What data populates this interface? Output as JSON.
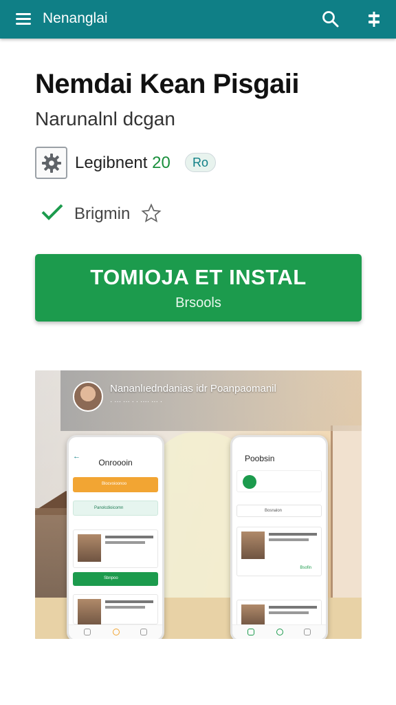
{
  "appbar": {
    "title": "Nenanglai",
    "icons": [
      "menu-icon",
      "search-icon",
      "tune-icon"
    ],
    "color": "#0f7f86"
  },
  "app": {
    "title": "Nemdai Kean Pisgaii",
    "developer": "Narunalnl dcgan",
    "rating_label": "Legibnent",
    "rating_value": "20",
    "badge": "Ro",
    "check_label": "Brigmin"
  },
  "install": {
    "label": "TOMIOJA ET INSTAL",
    "sublabel": "Brsools",
    "color": "#1c9b4d"
  },
  "screenshot": {
    "banner_title": "Nananlıedndanias idr Poanpaomanil",
    "banner_subtitle": "· ··· ··· · · ···· ··· ·",
    "phone_left": {
      "title": "Onroooin",
      "orange_row": "Blocvoioonoo",
      "pill": "Panolcdioicomn",
      "button": "Sbnpoo"
    },
    "phone_right": {
      "title": "Poobsin",
      "select": "Bosnalon",
      "link": "Bsofin"
    }
  }
}
